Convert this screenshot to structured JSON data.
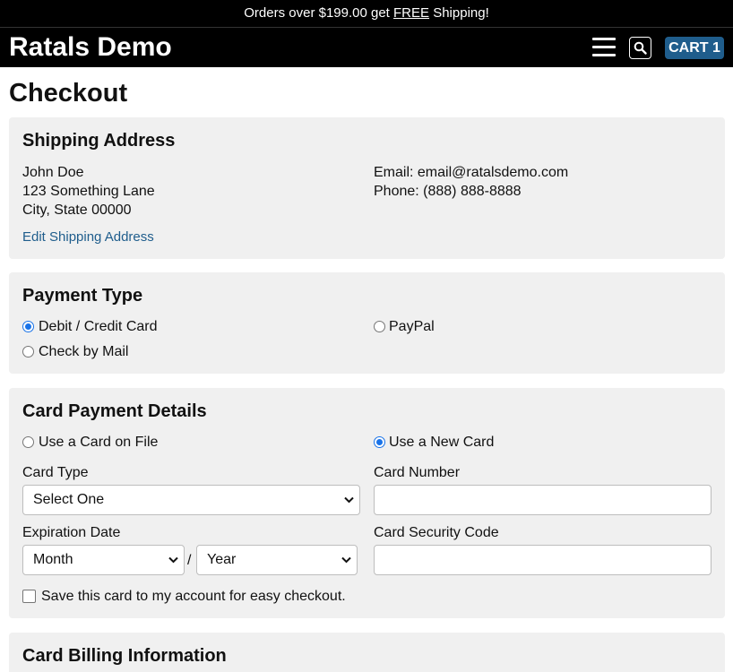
{
  "promo": {
    "before": "Orders over $199.00 get ",
    "highlight": "FREE",
    "after": " Shipping!"
  },
  "header": {
    "brand": "Ratals Demo",
    "cart_label": "CART 1"
  },
  "page": {
    "title": "Checkout"
  },
  "shipping": {
    "title": "Shipping Address",
    "name": "John Doe",
    "street": "123 Something Lane",
    "city_line": "City, State 00000",
    "email": "Email: email@ratalsdemo.com",
    "phone": "Phone: (888) 888-8888",
    "edit_link": "Edit Shipping Address"
  },
  "payment_type": {
    "title": "Payment Type",
    "options": [
      {
        "label": "Debit / Credit Card",
        "selected": true
      },
      {
        "label": "PayPal",
        "selected": false
      },
      {
        "label": "Check by Mail",
        "selected": false
      }
    ]
  },
  "card_details": {
    "title": "Card Payment Details",
    "card_on_file": "Use a Card on File",
    "new_card": "Use a New Card",
    "card_type_label": "Card Type",
    "card_type_value": "Select One",
    "card_number_label": "Card Number",
    "card_number_value": "",
    "expiration_label": "Expiration Date",
    "month_value": "Month",
    "slash": "/",
    "year_value": "Year",
    "security_code_label": "Card Security Code",
    "security_code_value": "",
    "save_card_label": "Save this card to my account for easy checkout."
  },
  "billing": {
    "title": "Card Billing Information"
  },
  "colors": {
    "accent": "#1f5d8c",
    "radio": "#1a73e8",
    "panel_bg": "#f0f0f0",
    "header_bg": "#000000"
  },
  "icons": {
    "menu": "hamburger-icon",
    "search": "search-icon",
    "dropdown": "chevron-down-icon"
  }
}
